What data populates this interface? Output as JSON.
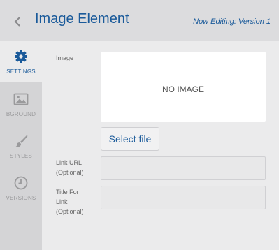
{
  "header": {
    "title": "Image Element",
    "editing": "Now Editing: Version 1"
  },
  "sidebar": {
    "items": [
      {
        "label": "SETTINGS",
        "icon": "gear-icon",
        "active": true
      },
      {
        "label": "BGROUND",
        "icon": "image-icon",
        "active": false
      },
      {
        "label": "STYLES",
        "icon": "brush-icon",
        "active": false
      },
      {
        "label": "VERSIONS",
        "icon": "clock-icon",
        "active": false
      }
    ]
  },
  "form": {
    "image_label": "Image",
    "no_image": "NO IMAGE",
    "select_file": "Select file",
    "link_url_label_1": "Link URL",
    "link_url_label_2": "(Optional)",
    "link_url_value": "",
    "title_label_1": "Title For",
    "title_label_2": "Link",
    "title_label_3": "(Optional)",
    "title_value": ""
  },
  "colors": {
    "accent": "#1a5a9a",
    "header_bg": "#dcdcde",
    "sidebar_bg": "#d4d4d6",
    "content_bg": "#ebebec"
  }
}
